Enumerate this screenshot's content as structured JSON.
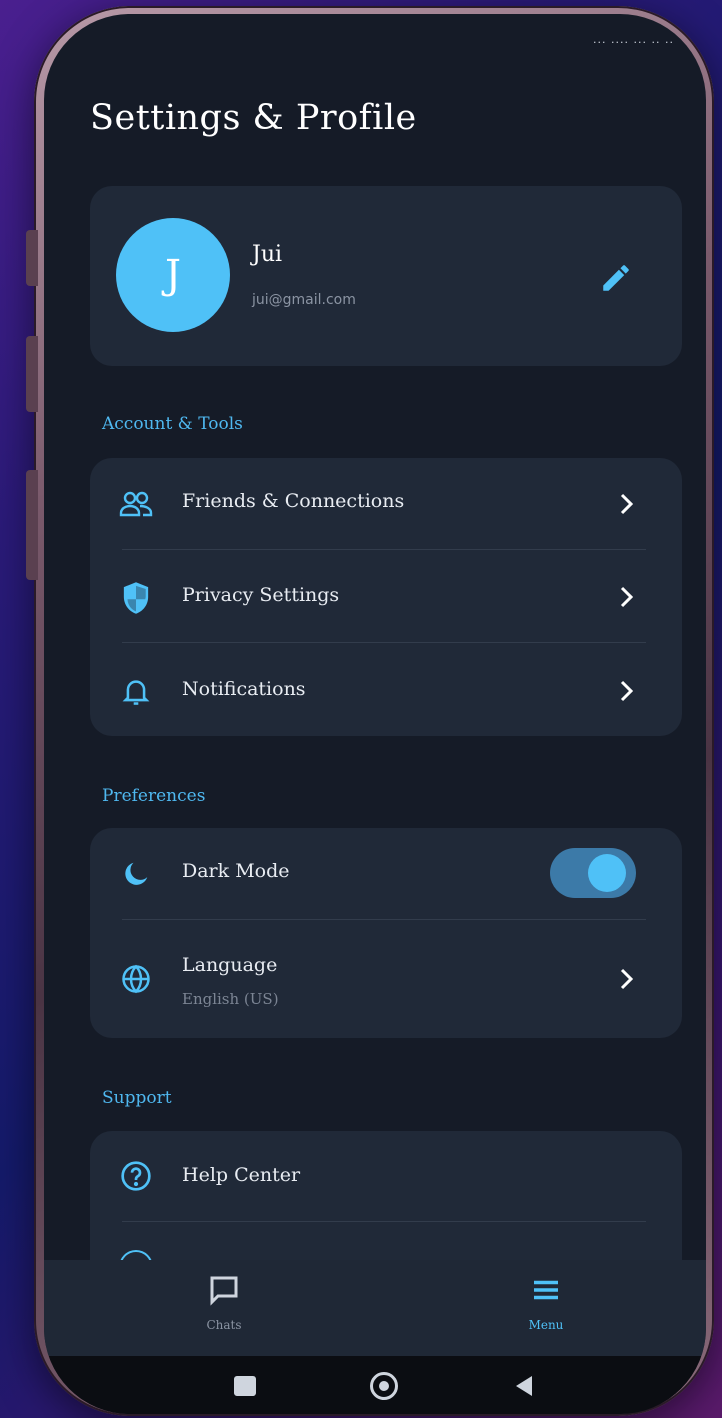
{
  "status_bar": {
    "text": "··· ···· ···  ·· ··"
  },
  "page": {
    "title": "Settings & Profile"
  },
  "profile": {
    "initial": "J",
    "name": "Jui",
    "email": "jui@gmail.com"
  },
  "sections": {
    "account": {
      "label": "Account & Tools",
      "items": [
        {
          "label": "Friends & Connections",
          "icon": "people-icon"
        },
        {
          "label": "Privacy Settings",
          "icon": "shield-icon"
        },
        {
          "label": "Notifications",
          "icon": "bell-icon"
        }
      ]
    },
    "preferences": {
      "label": "Preferences",
      "dark_mode": {
        "label": "Dark Mode",
        "icon": "moon-icon",
        "enabled": true
      },
      "language": {
        "label": "Language",
        "value": "English (US)",
        "icon": "globe-icon"
      }
    },
    "support": {
      "label": "Support",
      "items": [
        {
          "label": "Help Center",
          "icon": "help-icon"
        }
      ]
    }
  },
  "bottom_nav": {
    "items": [
      {
        "label": "Chats",
        "icon": "chat-icon",
        "active": false
      },
      {
        "label": "Menu",
        "icon": "menu-icon",
        "active": true
      }
    ]
  },
  "colors": {
    "accent": "#4fc1f7",
    "background": "#151b27",
    "card": "#202938",
    "section_label": "#4fb8f0"
  }
}
